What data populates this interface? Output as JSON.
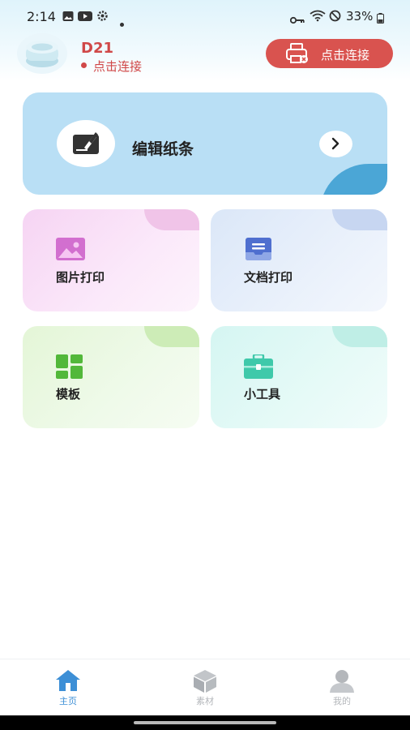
{
  "status_bar": {
    "time": "2:14",
    "battery": "33%"
  },
  "device": {
    "name": "D21",
    "connection_status": "点击连接"
  },
  "connect_button": {
    "label": "点击连接"
  },
  "edit_card": {
    "label": "编辑纸条"
  },
  "tiles": [
    {
      "label": "图片打印",
      "icon": "image-icon"
    },
    {
      "label": "文档打印",
      "icon": "document-icon"
    },
    {
      "label": "模板",
      "icon": "template-grid-icon"
    },
    {
      "label": "小工具",
      "icon": "toolbox-icon"
    }
  ],
  "bottom_nav": [
    {
      "label": "主页",
      "icon": "home-icon",
      "active": true
    },
    {
      "label": "素材",
      "icon": "cube-icon",
      "active": false
    },
    {
      "label": "我的",
      "icon": "user-icon",
      "active": false
    }
  ],
  "colors": {
    "accent_red": "#d9534f",
    "active_blue": "#3d8fd6",
    "edit_card": "#b9dff5"
  }
}
